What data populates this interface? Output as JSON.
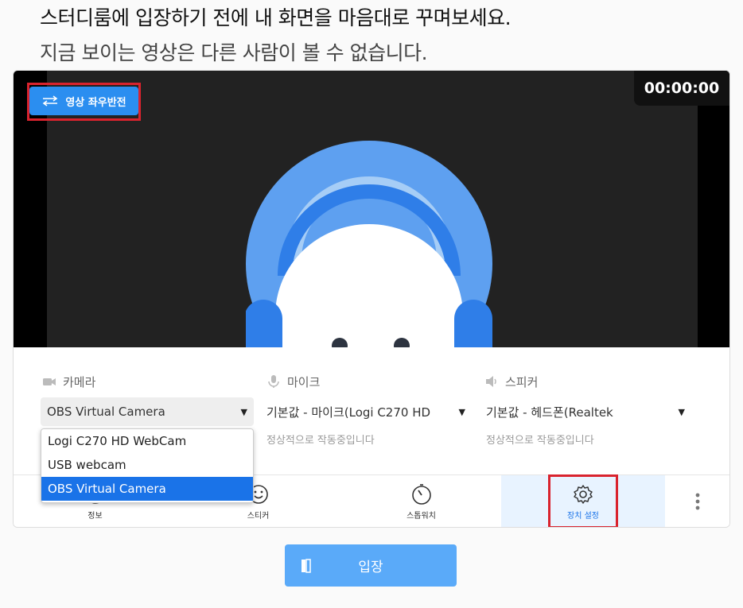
{
  "header": {
    "headline": "스터디룸에 입장하기 전에 내 화면을 마음대로 꾸며보세요.",
    "subline": "지금 보이는 영상은 다른 사람이 볼 수 없습니다."
  },
  "video": {
    "flip_label": "영상 좌우반전",
    "timer": "00:00:00"
  },
  "devices": {
    "camera": {
      "label": "카메라",
      "selected": "OBS Virtual Camera",
      "options": [
        "Logi C270 HD WebCam",
        "USB webcam",
        "OBS Virtual Camera"
      ]
    },
    "mic": {
      "label": "마이크",
      "selected": "기본값 - 마이크(Logi C270 HD",
      "status": "정상적으로 작동중입니다"
    },
    "speaker": {
      "label": "스피커",
      "selected": "기본값 - 헤드폰(Realtek",
      "status": "정상적으로 작동중입니다"
    }
  },
  "toolbar": {
    "info_label": "정보",
    "sticker_label": "스티커",
    "stopwatch_label": "스톱워치",
    "device_label": "장치 설정"
  },
  "enter_label": "입장",
  "colors": {
    "accent": "#2b8ef0",
    "highlight_outline": "#d9232e",
    "enter_button": "#5aaaf9",
    "selected_option": "#1a73e8"
  }
}
